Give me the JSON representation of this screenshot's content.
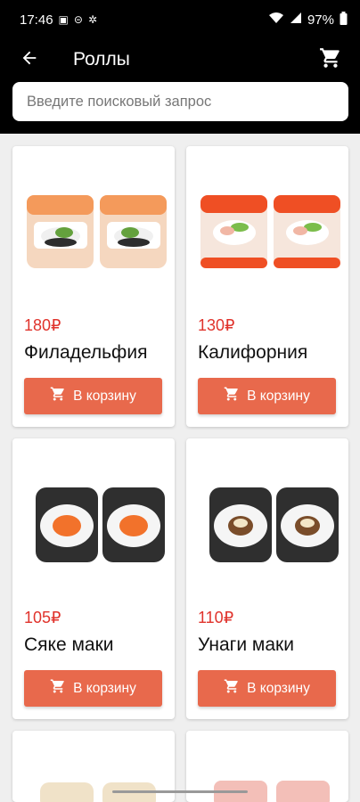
{
  "status_bar": {
    "time": "17:46",
    "battery": "97%"
  },
  "header": {
    "title": "Роллы"
  },
  "search": {
    "placeholder": "Введите поисковый запрос"
  },
  "products": [
    {
      "price": "180₽",
      "name": "Филадельфия",
      "button_label": "В корзину"
    },
    {
      "price": "130₽",
      "name": "Калифорния",
      "button_label": "В корзину"
    },
    {
      "price": "105₽",
      "name": "Сяке маки",
      "button_label": "В корзину"
    },
    {
      "price": "110₽",
      "name": "Унаги маки",
      "button_label": "В корзину"
    }
  ],
  "colors": {
    "accent": "#e8694c",
    "price": "#e0332c",
    "header_bg": "#000000",
    "page_bg": "#efefef"
  }
}
